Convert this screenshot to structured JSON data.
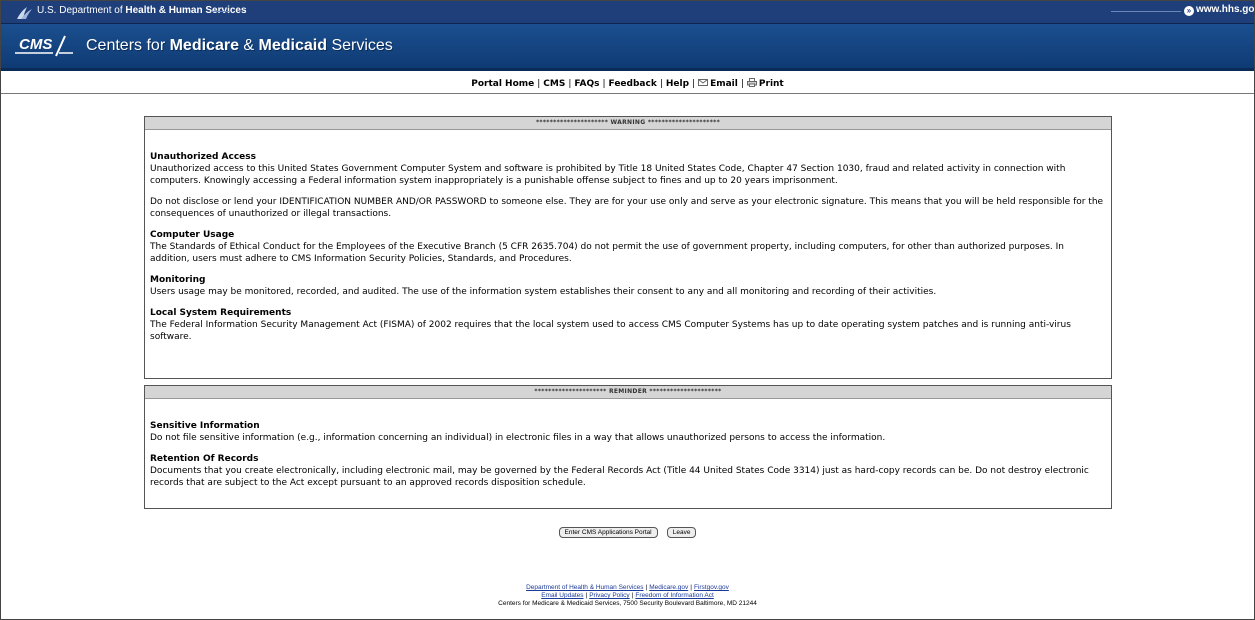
{
  "hhs_bar": {
    "label_prefix": "U.S. Department of ",
    "label_bold": "Health & Human Services",
    "link": "www.hhs.gov"
  },
  "cms_banner": {
    "logo_text": "CMS",
    "name_plain_1": "Centers for ",
    "name_bold_1": "Medicare",
    "name_plain_2": " & ",
    "name_bold_2": "Medicaid",
    "name_plain_3": " Services"
  },
  "nav": {
    "items": [
      "Portal Home",
      "CMS",
      "FAQs",
      "Feedback",
      "Help",
      "Email",
      "Print"
    ]
  },
  "warning_panel": {
    "header": "********************* WARNING *********************",
    "sections": [
      {
        "title": "Unauthorized Access",
        "text": "Unauthorized access to this United States Government Computer System and software is prohibited by Title 18 United States Code, Chapter 47 Section 1030, fraud and related activity in connection with computers. Knowingly accessing a Federal information system inappropriately is a punishable offense subject to fines and up to 20 years imprisonment."
      },
      {
        "title": "",
        "text": "Do not disclose or lend your IDENTIFICATION NUMBER AND/OR PASSWORD to someone else. They are for your use only and serve as your electronic signature. This means that you will be held responsible for the consequences of unauthorized or illegal transactions."
      },
      {
        "title": "Computer Usage",
        "text": "The Standards of Ethical Conduct for the Employees of the Executive Branch (5 CFR 2635.704) do not permit the use of government property, including computers, for other than authorized purposes. In addition, users must adhere to CMS Information Security Policies, Standards, and Procedures."
      },
      {
        "title": "Monitoring",
        "text": "Users usage may be monitored, recorded, and audited. The use of the information system establishes their consent to any and all monitoring and recording of their activities."
      },
      {
        "title": "Local System Requirements",
        "text": "The Federal Information Security Management Act (FISMA) of 2002 requires that the local system used to access CMS Computer Systems has up to date operating system patches and is running anti-virus software."
      }
    ]
  },
  "reminder_panel": {
    "header": "********************* REMINDER *********************",
    "sections": [
      {
        "title": "Sensitive Information",
        "text": "Do not file sensitive information (e.g., information concerning an individual) in electronic files in a way that allows unauthorized persons to access the information."
      },
      {
        "title": "Retention Of Records",
        "text": "Documents that you create electronically, including electronic mail, may be governed by the Federal Records Act (Title 44 United States Code 3314) just as hard-copy records can be. Do not destroy electronic records that are subject to the Act except pursuant to an approved records disposition schedule."
      }
    ]
  },
  "buttons": {
    "enter": "Enter CMS Applications Portal",
    "leave": "Leave"
  },
  "footer": {
    "links_row1": [
      "Department of Health & Human Services",
      "Medicare.gov",
      "Firstgov.gov"
    ],
    "links_row2": [
      "Email Updates",
      "Privacy Policy",
      "Freedom of Information Act"
    ],
    "address": "Centers for Medicare & Medicaid Services, 7500 Security Boulevard Baltimore, MD 21244"
  },
  "colors": {
    "hhs_bar": "#1f3f7a",
    "cms_banner": "#1b4f8f",
    "panel_header": "#d5d5d5",
    "link": "#1a3a9a"
  },
  "icons": [
    "hhs-eagle-icon",
    "cms-logo",
    "circle-arrow-icon",
    "email-icon",
    "print-icon"
  ]
}
